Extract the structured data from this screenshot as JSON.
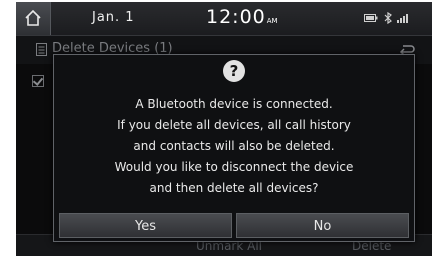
{
  "status_bar": {
    "date": "Jan.  1",
    "time": "12:00",
    "ampm": "AM"
  },
  "page": {
    "title": "Delete Devices (1)",
    "bottom_buttons": [
      "Unmark All",
      "Delete"
    ]
  },
  "dialog": {
    "lines": [
      "A Bluetooth device is connected.",
      "If you delete all devices, all call history",
      "and contacts will also be deleted.",
      "Would you like to disconnect the device",
      "and then delete all devices?"
    ],
    "yes_label": "Yes",
    "no_label": "No"
  },
  "colors": {
    "background": "#0b0b0c",
    "dialog_border": "#606368",
    "text": "#eaeaea"
  }
}
